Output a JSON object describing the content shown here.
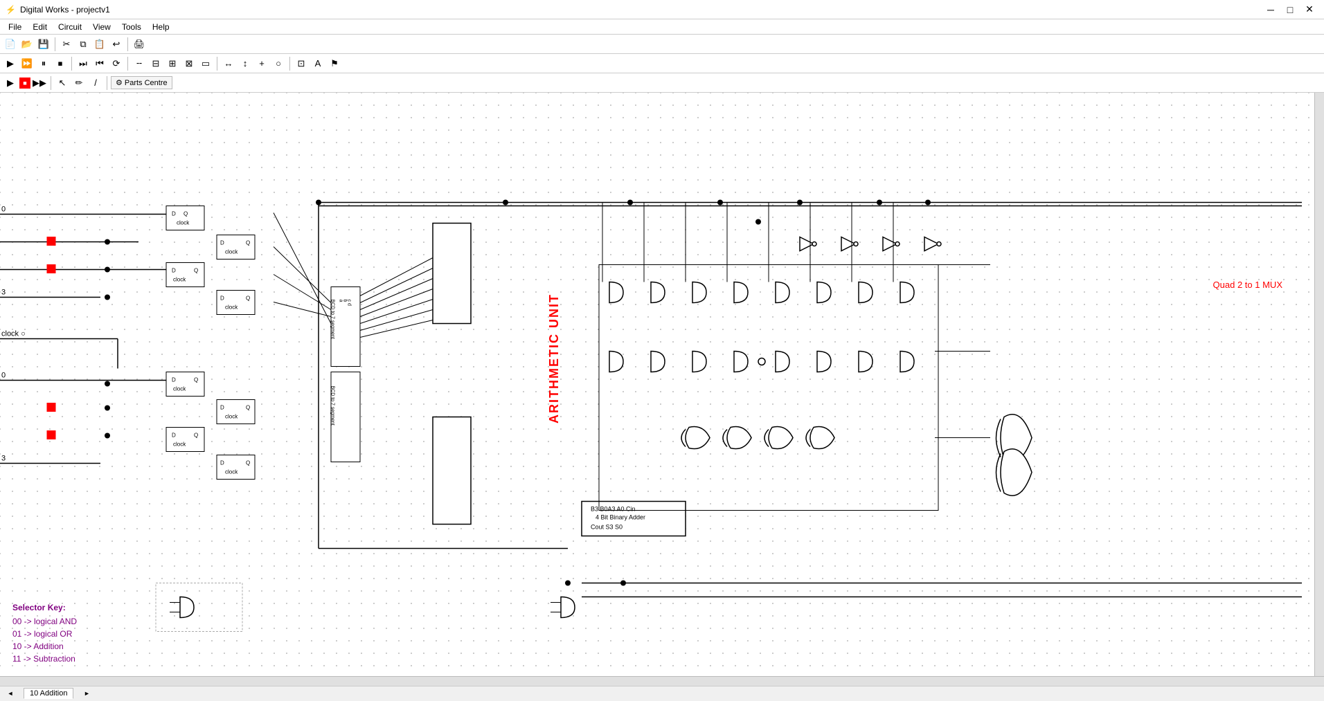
{
  "app": {
    "title": "Digital Works - projectv1",
    "icon": "⚡"
  },
  "title_bar": {
    "title": "Digital Works - projectv1",
    "minimize": "─",
    "maximize": "□",
    "close": "✕"
  },
  "menu": {
    "items": [
      "File",
      "Edit",
      "Circuit",
      "View",
      "Tools",
      "Help"
    ]
  },
  "toolbar1": {
    "buttons": [
      "new",
      "open",
      "save",
      "sep",
      "cut",
      "copy",
      "paste",
      "sep",
      "print"
    ]
  },
  "toolbar2": {
    "buttons": [
      "play",
      "step",
      "pause",
      "stop",
      "sep",
      "various controls"
    ]
  },
  "toolbar3": {
    "parts_centre": "Parts Centre"
  },
  "circuit": {
    "arithmetic_unit_label": "ARITHMETIC UNIT",
    "quad_mux_label": "Quad 2 to 1 MUX",
    "adder_label": "4 Bit Binary Adder",
    "adder_pins_top": "B3  B0A3  A0  Cin",
    "adder_pins_bot": "Cout  S3        S0",
    "clock_label": "clock"
  },
  "selector_key": {
    "title": "Selector Key:",
    "items": [
      "00 -> logical AND",
      "01 -> logical OR",
      "10 -> Addition",
      "11 -> Subtraction"
    ]
  },
  "status_bar": {
    "tabs": [
      "10 Addition"
    ],
    "scroll_left": "◄",
    "scroll_right": "►"
  }
}
